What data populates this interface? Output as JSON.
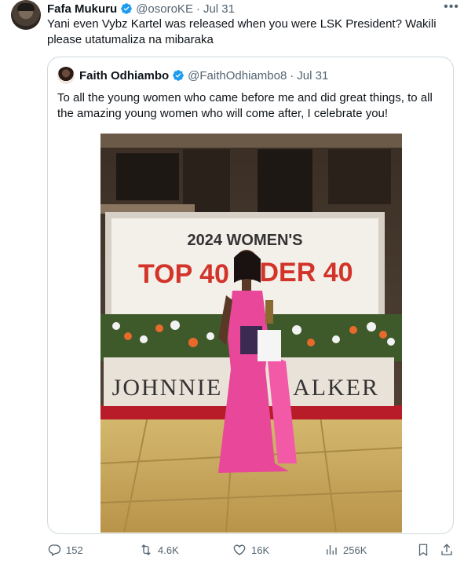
{
  "tweet": {
    "author_name": "Fafa Mukuru",
    "handle": "@osoroKE",
    "separator": "·",
    "time": "Jul 31",
    "text": "Yani even Vybz Kartel was released when you were LSK President? Wakili please utatumaliza na mibaraka"
  },
  "quote": {
    "author_name": "Faith Odhiambo",
    "handle": "@FaithOdhiambo8",
    "separator": "·",
    "time": "Jul 31",
    "text": "To all the young women who came before me and did great things, to all the amazing young women who will come after, I celebrate you!",
    "image": {
      "banner_line1": "2024 WOMEN'S",
      "banner_top": "TOP 40",
      "banner_end": "DER 40",
      "base_left": "JOHNNIE",
      "base_right": "ALKER"
    }
  },
  "actions": {
    "replies": "152",
    "reposts": "4.6K",
    "likes": "16K",
    "views": "256K"
  },
  "colors": {
    "verified": "#1d9bf0",
    "banner_red": "#d3342a",
    "dress_pink": "#e8479a"
  }
}
